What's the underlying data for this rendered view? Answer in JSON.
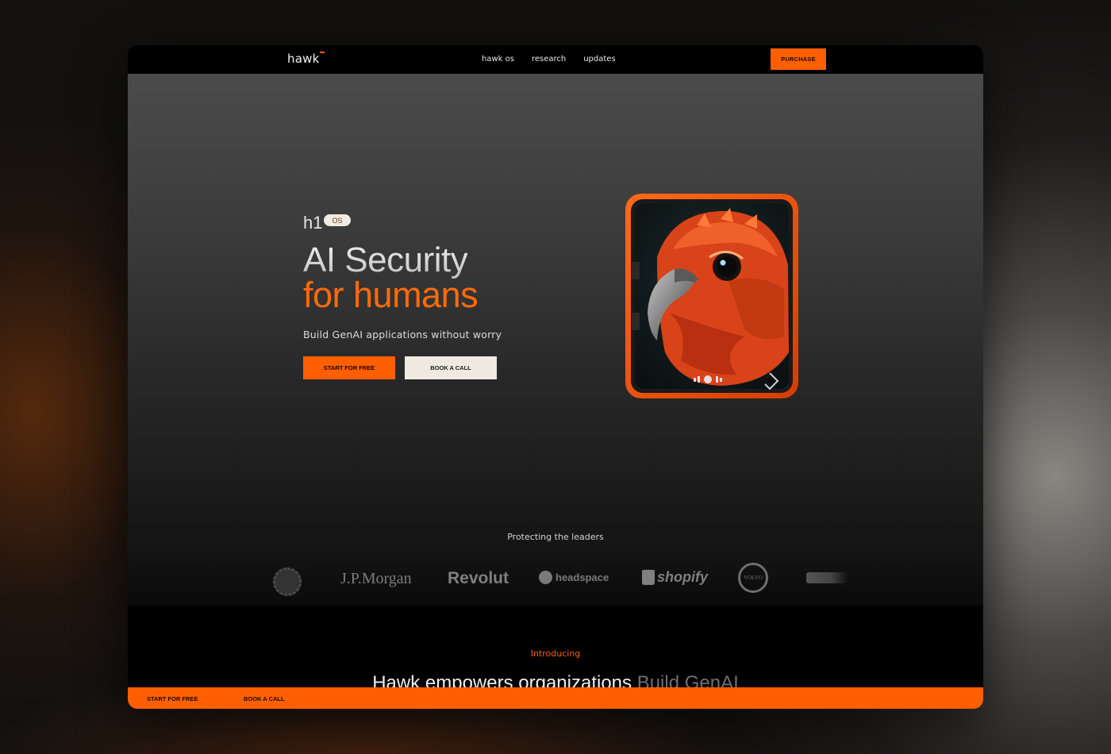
{
  "nav": {
    "logo": "hawk",
    "links": [
      "hawk os",
      "research",
      "updates"
    ],
    "purchase_label": "PURCHASE"
  },
  "hero": {
    "product": "h1",
    "badge": "OS",
    "headline_line1": "AI Security",
    "headline_line2": "for humans",
    "subline": "Build GenAI applications without worry",
    "start_label": "START FOR FREE",
    "book_label": "BOOK A CALL"
  },
  "leaders": {
    "heading": "Protecting the leaders",
    "logos": [
      "J.P.Morgan",
      "Revolut",
      "headspace",
      "shopify",
      "VOLVO"
    ]
  },
  "intro": {
    "eyebrow": "Introducing",
    "headline_main": "Hawk empowers organizations",
    "headline_muted": "Build GenAI"
  },
  "bottom_bar": {
    "start_label": "START FOR FREE",
    "book_label": "BOOK A CALL"
  },
  "colors": {
    "accent": "#ff5f00",
    "cream": "#efeae0",
    "bg": "#000000"
  }
}
